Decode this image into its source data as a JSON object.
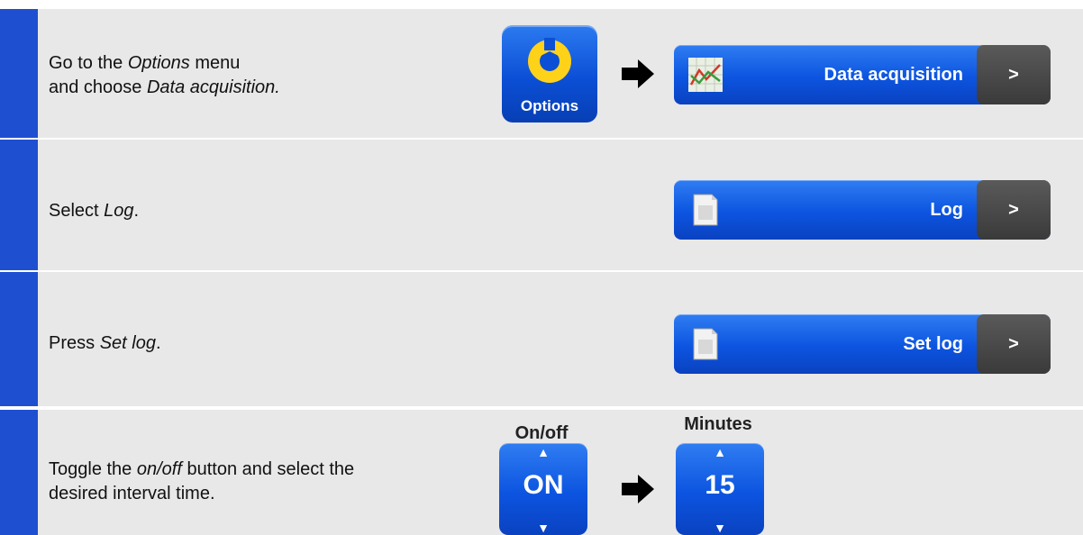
{
  "steps": [
    {
      "text_parts": [
        "Go to the ",
        "Options",
        " menu",
        "and choose ",
        "Data acquisition."
      ],
      "options_button": {
        "label": "Options",
        "icon": "wrench-icon"
      },
      "menu_button": {
        "label": "Data acquisition",
        "icon": "graph-icon",
        "chevron": ">"
      }
    },
    {
      "text_parts": [
        "Select ",
        "Log",
        "."
      ],
      "menu_button": {
        "label": "Log",
        "icon": "document-icon",
        "chevron": ">"
      }
    },
    {
      "text_parts": [
        "Press ",
        "Set log",
        "."
      ],
      "menu_button": {
        "label": "Set log",
        "icon": "document-icon",
        "chevron": ">"
      }
    },
    {
      "text_parts": [
        "Toggle the ",
        "on/off",
        " button and select the",
        "desired interval time."
      ],
      "onoff": {
        "title": "On/off",
        "value": "ON",
        "up": "▲",
        "down": "▼"
      },
      "minutes": {
        "title": "Minutes",
        "value": "15",
        "up": "▲",
        "down": "▼"
      }
    }
  ],
  "colors": {
    "accent_bar": "#1f4fd1",
    "row_bg": "#e8e8e8",
    "button_blue": "#0c54e0",
    "chevron_gray": "#444444"
  }
}
